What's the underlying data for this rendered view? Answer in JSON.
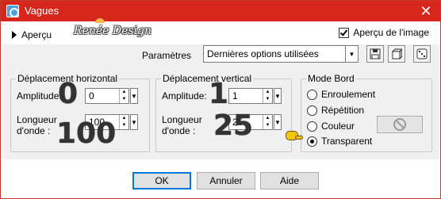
{
  "window": {
    "title": "Vagues",
    "close_glyph": "✕"
  },
  "watermark": {
    "text": "Renée Design"
  },
  "top": {
    "apercu_label": "Aperçu",
    "preview_label": "Aperçu de l'image",
    "preview_checked": true
  },
  "params": {
    "label": "Paramètres",
    "selected": "Dernières options utilisées",
    "tool_icons": [
      "save-preset-icon",
      "reset-icon",
      "randomize-icon"
    ]
  },
  "horizontal": {
    "title": "Déplacement horizontal",
    "amplitude_label": "Amplitude:",
    "amplitude_value": "0",
    "wavelength_label_1": "Longueur",
    "wavelength_label_2": "d'onde :",
    "wavelength_value": "100",
    "annotation_amplitude": "0",
    "annotation_wavelength": "100"
  },
  "vertical": {
    "title": "Déplacement vertical",
    "amplitude_label": "Amplitude:",
    "amplitude_value": "1",
    "wavelength_label_1": "Longueur",
    "wavelength_label_2": "d'onde :",
    "wavelength_value": "25",
    "annotation_amplitude": "1",
    "annotation_wavelength": "25"
  },
  "edge_mode": {
    "title": "Mode Bord",
    "options": [
      "Enroulement",
      "Répétition",
      "Couleur",
      "Transparent"
    ],
    "selected": "Transparent"
  },
  "buttons": {
    "ok": "OK",
    "cancel": "Annuler",
    "help": "Aide"
  },
  "colors": {
    "titlebar": "#d7261c",
    "accent": "#0078d7"
  }
}
